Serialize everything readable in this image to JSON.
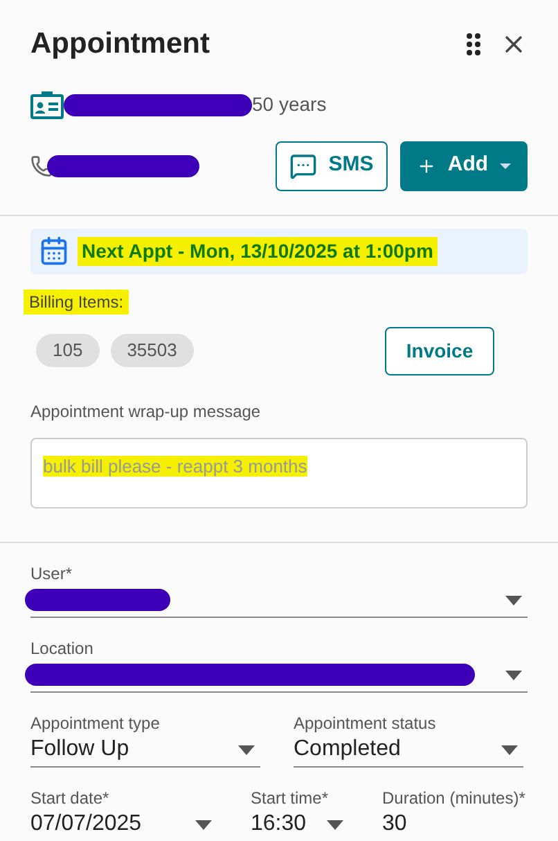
{
  "title": "Appointment",
  "patient": {
    "redacted": true,
    "age": "50 years"
  },
  "phone": {
    "redacted": true
  },
  "buttons": [
    {
      "kind": "outline",
      "label": "SMS"
    },
    {
      "kind": "menu",
      "label": "Add"
    }
  ],
  "next_appt": {
    "text": "Next Appt - Mon, 13/10/2025 at 1:00pm",
    "highlighted": true
  },
  "billing": {
    "label": "Billing Items:",
    "highlighted": true,
    "items": [
      "105",
      "35503"
    ],
    "button": "Invoice"
  },
  "wrapup": {
    "label": "Appointment wrap-up message",
    "value": "bulk bill please - reappt 3 months",
    "highlighted": true
  },
  "field_rows": [
    [
      {
        "kind": "select",
        "label": "User*",
        "redacted": true
      }
    ],
    [
      {
        "kind": "select",
        "label": "Location",
        "redacted": true
      }
    ],
    [
      {
        "kind": "select",
        "label": "Appointment type",
        "value": "Follow Up"
      },
      {
        "kind": "select",
        "label": "Appointment status",
        "value": "Completed"
      }
    ],
    [
      {
        "kind": "select",
        "label": "Start date*",
        "value": "07/07/2025"
      },
      {
        "kind": "select",
        "label": "Start time*",
        "value": "16:30"
      },
      {
        "kind": "text",
        "label": "Duration (minutes)*",
        "value": "30"
      }
    ]
  ]
}
